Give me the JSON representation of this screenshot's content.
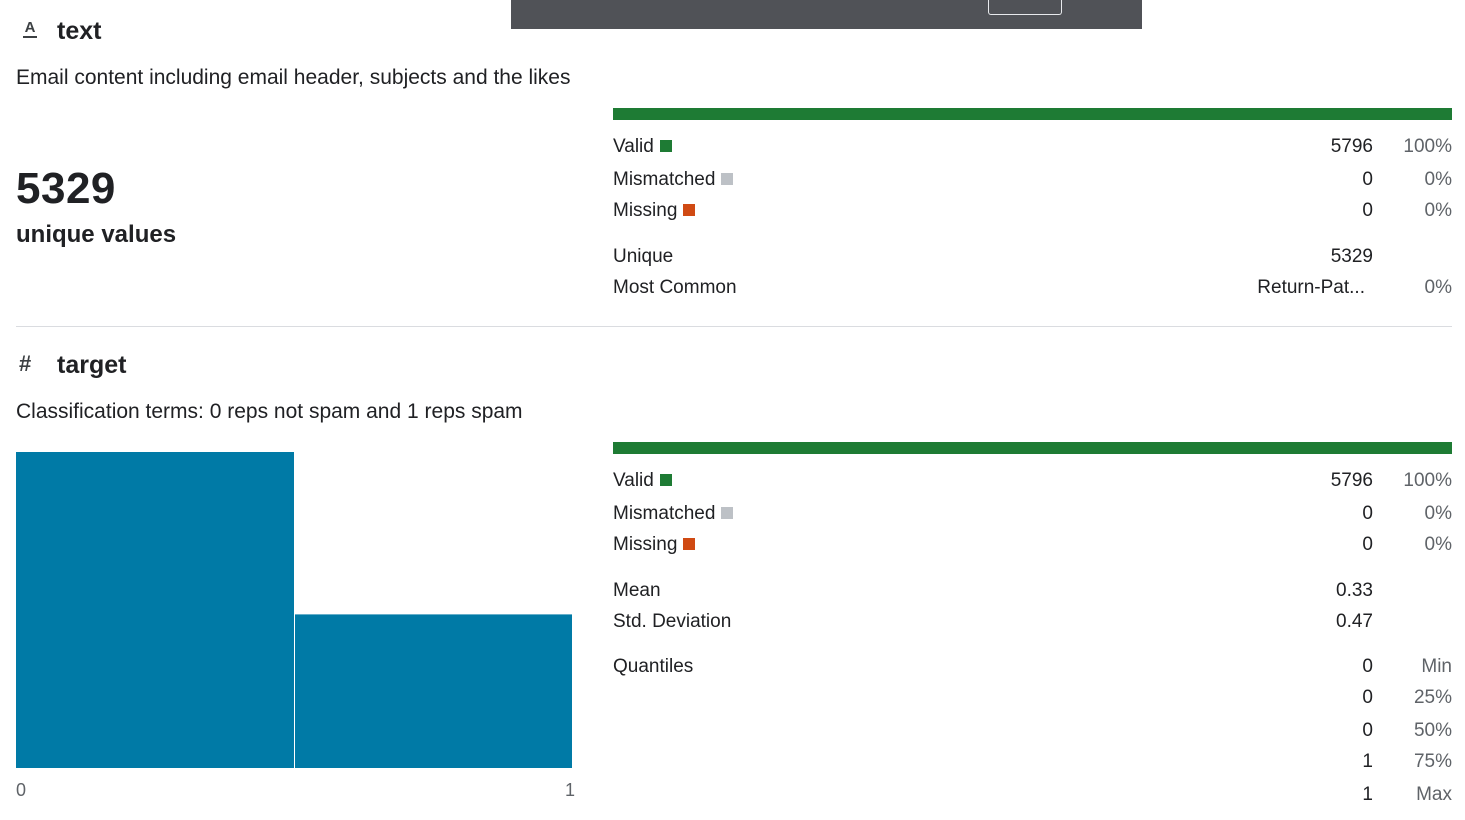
{
  "columns": [
    {
      "type_icon": "text-type-icon",
      "name": "text",
      "description": "Email content including email header, subjects and the likes",
      "summary_value": "5329",
      "summary_label": "unique values",
      "validity_bar": {
        "valid_fraction": 1.0
      },
      "stats": {
        "valid": {
          "label": "Valid",
          "count": "5796",
          "pct": "100%",
          "color": "#1e7b34"
        },
        "mismatched": {
          "label": "Mismatched",
          "count": "0",
          "pct": "0%",
          "color": "#bdc1c6"
        },
        "missing": {
          "label": "Missing",
          "count": "0",
          "pct": "0%",
          "color": "#d04a13"
        },
        "unique": {
          "label": "Unique",
          "value": "5329"
        },
        "most_common": {
          "label": "Most Common",
          "value": "Return-Pat...",
          "pct": "0%"
        }
      }
    },
    {
      "type_icon": "numeric-type-icon",
      "name": "target",
      "icon_glyph": "#",
      "description": "Classification terms: 0 reps not spam and 1 reps spam",
      "validity_bar": {
        "valid_fraction": 1.0
      },
      "stats": {
        "valid": {
          "label": "Valid",
          "count": "5796",
          "pct": "100%",
          "color": "#1e7b34"
        },
        "mismatched": {
          "label": "Mismatched",
          "count": "0",
          "pct": "0%",
          "color": "#bdc1c6"
        },
        "missing": {
          "label": "Missing",
          "count": "0",
          "pct": "0%",
          "color": "#d04a13"
        },
        "mean": {
          "label": "Mean",
          "value": "0.33"
        },
        "std": {
          "label": "Std. Deviation",
          "value": "0.47"
        },
        "quantiles": {
          "label": "Quantiles",
          "rows": [
            {
              "value": "0",
              "name": "Min"
            },
            {
              "value": "0",
              "name": "25%"
            },
            {
              "value": "0",
              "name": "50%"
            },
            {
              "value": "1",
              "name": "75%"
            },
            {
              "value": "1",
              "name": "Max"
            }
          ]
        }
      }
    }
  ],
  "histogram": {
    "type": "bar",
    "bins": [
      {
        "from": 0,
        "to": 0.5,
        "count": 3900
      },
      {
        "from": 0.5,
        "to": 1,
        "count": 1896
      }
    ],
    "x_ticks": [
      "0",
      "1"
    ],
    "bar_color": "#007aa6"
  }
}
